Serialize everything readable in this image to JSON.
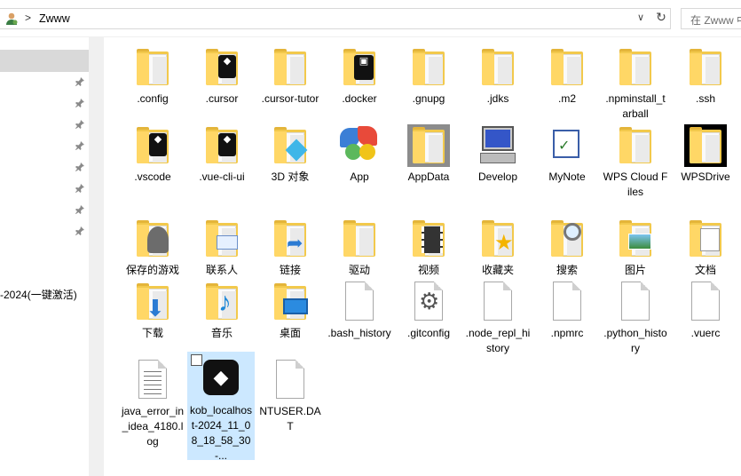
{
  "address": {
    "path": "Zwww",
    "separator": ">",
    "search_placeholder": "在 Zwww 中搜索"
  },
  "nav": {
    "partial_item": "-2024(一键激活)"
  },
  "items": [
    {
      "label": ".config",
      "icon": "folder-icon"
    },
    {
      "label": ".cursor",
      "icon": "cursor-folder-icon"
    },
    {
      "label": ".cursor-tutor",
      "icon": "folder-icon"
    },
    {
      "label": ".docker",
      "icon": "docker-folder-icon"
    },
    {
      "label": ".gnupg",
      "icon": "folder-icon"
    },
    {
      "label": ".jdks",
      "icon": "folder-icon"
    },
    {
      "label": ".m2",
      "icon": "folder-icon"
    },
    {
      "label": ".npminstall_tarball",
      "icon": "folder-icon"
    },
    {
      "label": ".ssh",
      "icon": "folder-icon"
    },
    {
      "label": ".vscode",
      "icon": "cursor-folder-icon"
    },
    {
      "label": ".vue-cli-ui",
      "icon": "cursor-folder-icon"
    },
    {
      "label": "3D 对象",
      "icon": "3d-objects-folder-icon"
    },
    {
      "label": "App",
      "icon": "app-logo-icon"
    },
    {
      "label": "AppData",
      "icon": "appdata-folder-icon"
    },
    {
      "label": "Develop",
      "icon": "computer-icon"
    },
    {
      "label": "MyNote",
      "icon": "mynote-icon"
    },
    {
      "label": "WPS Cloud Files",
      "icon": "folder-icon"
    },
    {
      "label": "WPSDrive",
      "icon": "wpsdrive-folder-icon"
    },
    {
      "label": "保存的游戏",
      "icon": "saved-games-folder-icon"
    },
    {
      "label": "联系人",
      "icon": "contacts-folder-icon"
    },
    {
      "label": "链接",
      "icon": "links-folder-icon"
    },
    {
      "label": "驱动",
      "icon": "folder-icon"
    },
    {
      "label": "视频",
      "icon": "videos-folder-icon"
    },
    {
      "label": "收藏夹",
      "icon": "favorites-folder-icon"
    },
    {
      "label": "搜索",
      "icon": "searches-folder-icon"
    },
    {
      "label": "图片",
      "icon": "pictures-folder-icon"
    },
    {
      "label": "文档",
      "icon": "documents-folder-icon"
    },
    {
      "label": "下载",
      "icon": "downloads-folder-icon"
    },
    {
      "label": "音乐",
      "icon": "music-folder-icon"
    },
    {
      "label": "桌面",
      "icon": "desktop-folder-icon"
    },
    {
      "label": ".bash_history",
      "icon": "file-icon"
    },
    {
      "label": ".gitconfig",
      "icon": "gear-file-icon"
    },
    {
      "label": ".node_repl_history",
      "icon": "file-icon"
    },
    {
      "label": ".npmrc",
      "icon": "file-icon"
    },
    {
      "label": ".python_history",
      "icon": "file-icon"
    },
    {
      "label": ".vuerc",
      "icon": "file-icon"
    },
    {
      "label": "java_error_in_idea_4180.log",
      "icon": "text-file-icon"
    },
    {
      "label": "kob_localhost-2024_11_08_18_58_30-...",
      "icon": "cursor-app-icon"
    },
    {
      "label": "NTUSER.DAT",
      "icon": "file-icon"
    }
  ]
}
